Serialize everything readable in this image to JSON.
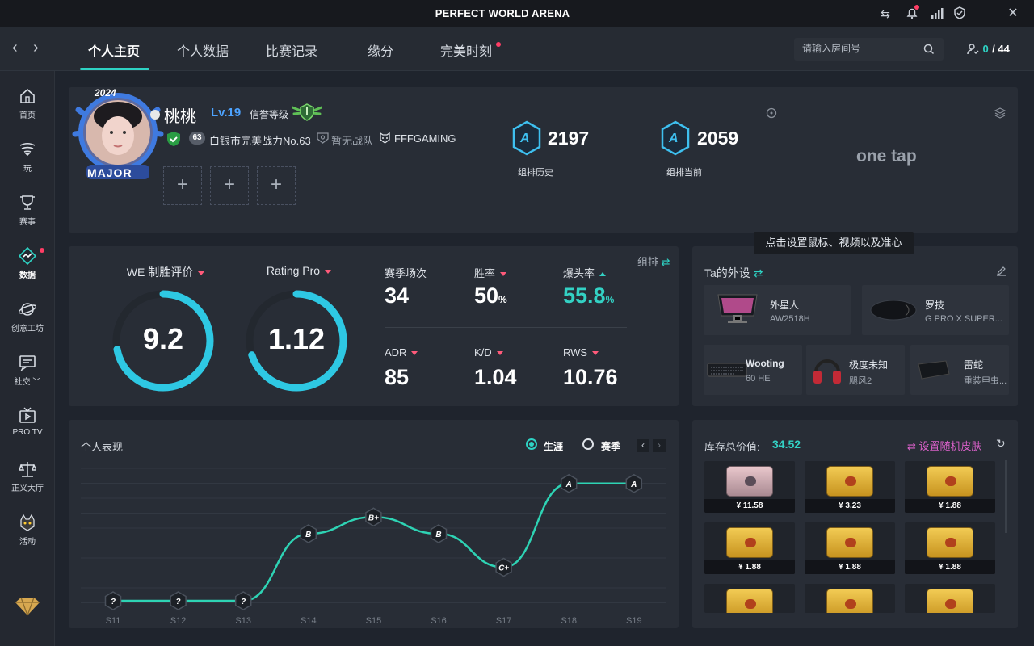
{
  "window": {
    "title": "PERFECT WORLD ARENA"
  },
  "nav": {
    "back": "‹",
    "forward": "›",
    "tabs": [
      {
        "label": "个人主页",
        "active": true
      },
      {
        "label": "个人数据"
      },
      {
        "label": "比赛记录"
      },
      {
        "label": "缘分"
      },
      {
        "label": "完美时刻",
        "dot": true
      }
    ],
    "search_placeholder": "请输入房间号",
    "online_count": "0",
    "online_total": "/ 44"
  },
  "sidebar": {
    "items": [
      {
        "label": "首页",
        "icon": "home-icon"
      },
      {
        "label": "玩",
        "icon": "play-icon"
      },
      {
        "label": "赛事",
        "icon": "trophy-icon"
      },
      {
        "label": "数据",
        "icon": "data-icon",
        "active": true,
        "dot": true
      },
      {
        "label": "创意工坊",
        "icon": "workshop-icon"
      },
      {
        "label": "社交 ﹀",
        "icon": "social-icon"
      },
      {
        "label": "PRO TV",
        "icon": "tv-icon"
      },
      {
        "label": "正义大厅",
        "icon": "justice-icon"
      },
      {
        "label": "活动",
        "icon": "activity-icon"
      }
    ]
  },
  "profile": {
    "name": "桃桃",
    "level": "Lv.19",
    "credit_label": "信誉等级",
    "badge_level": "63",
    "region_rank": "白银市完美战力No.63",
    "team": "暂无战队",
    "club": "FFFGAMING",
    "avatar_frame_year": "2024",
    "avatar_frame_text": "MAJOR",
    "elo": [
      {
        "value": "2197",
        "label": "组排历史",
        "tier": "A"
      },
      {
        "value": "2059",
        "label": "组排当前",
        "tier": "A"
      }
    ],
    "motto": "one tap"
  },
  "stats": {
    "mode": "组排",
    "rings": [
      {
        "label": "WE 制胜评价",
        "value": "9.2",
        "fraction": 0.72
      },
      {
        "label": "Rating Pro",
        "value": "1.12",
        "fraction": 0.7
      }
    ],
    "cells": [
      {
        "label": "赛季场次",
        "value": "34",
        "unit": ""
      },
      {
        "label": "胜率",
        "value": "50",
        "unit": "%"
      },
      {
        "label": "爆头率",
        "value": "55.8",
        "unit": "%",
        "highlight": true
      },
      {
        "label": "ADR",
        "value": "85",
        "unit": ""
      },
      {
        "label": "K/D",
        "value": "1.04",
        "unit": ""
      },
      {
        "label": "RWS",
        "value": "10.76",
        "unit": ""
      }
    ]
  },
  "gear": {
    "title": "Ta的外设",
    "tooltip": "点击设置鼠标、视频以及准心",
    "items": [
      {
        "name": "外星人",
        "model": "AW2518H"
      },
      {
        "name": "罗技",
        "model": "G PRO X SUPER..."
      },
      {
        "name": "Wooting",
        "model": "60 HE"
      },
      {
        "name": "极度未知",
        "model": "飓风2"
      },
      {
        "name": "雷蛇",
        "model": "重装甲虫..."
      }
    ]
  },
  "performance": {
    "title": "个人表现",
    "legend_career": "生涯",
    "legend_season": "赛季",
    "chart_data": {
      "type": "line",
      "x": [
        "S11",
        "S12",
        "S13",
        "S14",
        "S15",
        "S16",
        "S17",
        "S18",
        "S19"
      ],
      "series": [
        {
          "values": [
            "?",
            "?",
            "?",
            "B",
            "B+",
            "B",
            "C+",
            "A",
            "A"
          ]
        }
      ]
    }
  },
  "inventory": {
    "label": "库存总价值:",
    "total": "34.52",
    "random_skin": "设置随机皮肤",
    "items": [
      {
        "price": "¥ 11.58",
        "style": "pink"
      },
      {
        "price": "¥ 3.23"
      },
      {
        "price": "¥ 1.88"
      },
      {
        "price": "¥ 1.88"
      },
      {
        "price": "¥ 1.88"
      },
      {
        "price": "¥ 1.88"
      },
      {
        "price": ""
      },
      {
        "price": ""
      },
      {
        "price": ""
      }
    ]
  },
  "colors": {
    "accent": "#2ed3c4",
    "alert": "#ff3d65",
    "panel": "#282d36"
  }
}
